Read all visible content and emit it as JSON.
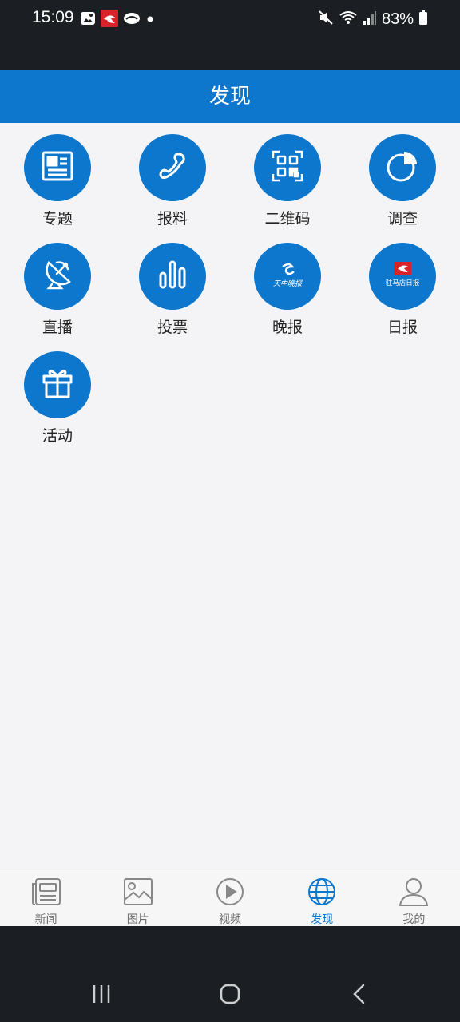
{
  "status_bar": {
    "time": "15:09",
    "battery": "83%",
    "icons_left": [
      "gallery-icon",
      "app-red-icon",
      "cloud-icon",
      "dot-icon"
    ],
    "icons_right": [
      "mute-icon",
      "wifi-icon",
      "signal-icon",
      "battery-icon"
    ]
  },
  "header": {
    "title": "发现"
  },
  "tiles": [
    {
      "label": "专题",
      "icon": "newspaper-icon"
    },
    {
      "label": "报料",
      "icon": "phone-icon"
    },
    {
      "label": "二维码",
      "icon": "qr-code-icon"
    },
    {
      "label": "调查",
      "icon": "pie-chart-icon"
    },
    {
      "label": "直播",
      "icon": "satellite-dish-icon"
    },
    {
      "label": "投票",
      "icon": "bar-chart-icon"
    },
    {
      "label": "晚报",
      "icon": "evening-news-logo-icon",
      "logo_text": "天中晚报"
    },
    {
      "label": "日报",
      "icon": "daily-news-logo-icon",
      "logo_text": "驻马店日报"
    },
    {
      "label": "活动",
      "icon": "gift-icon"
    }
  ],
  "bottom_nav": {
    "items": [
      {
        "label": "新闻",
        "icon": "news-icon",
        "active": false
      },
      {
        "label": "图片",
        "icon": "image-icon",
        "active": false
      },
      {
        "label": "视频",
        "icon": "play-icon",
        "active": false
      },
      {
        "label": "发现",
        "icon": "globe-icon",
        "active": true
      },
      {
        "label": "我的",
        "icon": "user-icon",
        "active": false
      }
    ]
  },
  "colors": {
    "accent": "#0c77cd",
    "status_bar": "#1b1e22",
    "background": "#f4f4f6"
  }
}
